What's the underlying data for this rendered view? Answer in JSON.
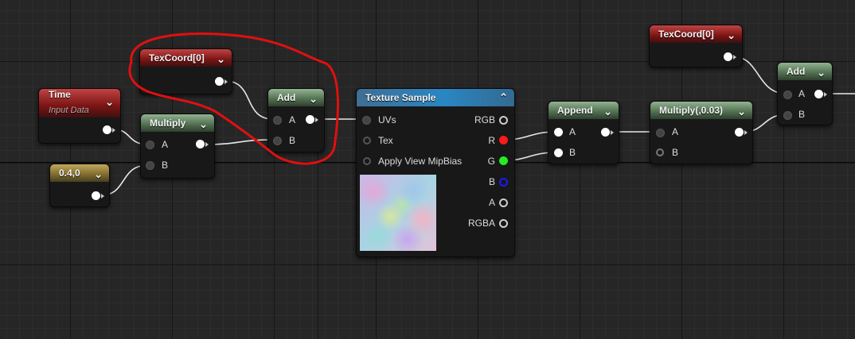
{
  "nodes": {
    "texcoord_left": {
      "title": "TexCoord[0]"
    },
    "texcoord_right": {
      "title": "TexCoord[0]"
    },
    "time": {
      "title": "Time",
      "subtitle": "Input Data"
    },
    "constant": {
      "title": "0.4,0"
    },
    "multiply_left": {
      "title": "Multiply",
      "pin_a": "A",
      "pin_b": "B"
    },
    "add_left": {
      "title": "Add",
      "pin_a": "A",
      "pin_b": "B"
    },
    "texture_sample": {
      "title": "Texture Sample",
      "inputs": [
        "UVs",
        "Tex",
        "Apply View MipBias"
      ],
      "outputs": [
        "RGB",
        "R",
        "G",
        "B",
        "A",
        "RGBA"
      ]
    },
    "append": {
      "title": "Append",
      "pin_a": "A",
      "pin_b": "B"
    },
    "multiply_right": {
      "title": "Multiply(,0.03)",
      "pin_a": "A",
      "pin_b": "B"
    },
    "add_right": {
      "title": "Add",
      "pin_a": "A",
      "pin_b": "B"
    }
  },
  "colors": {
    "r_pin": "#ff1a1a",
    "g_pin": "#22ee22",
    "b_pin": "#1a1aff",
    "highlight": "#e01010"
  },
  "icons": {
    "collapse": "chevron-down-icon",
    "expand": "chevron-up-icon"
  }
}
